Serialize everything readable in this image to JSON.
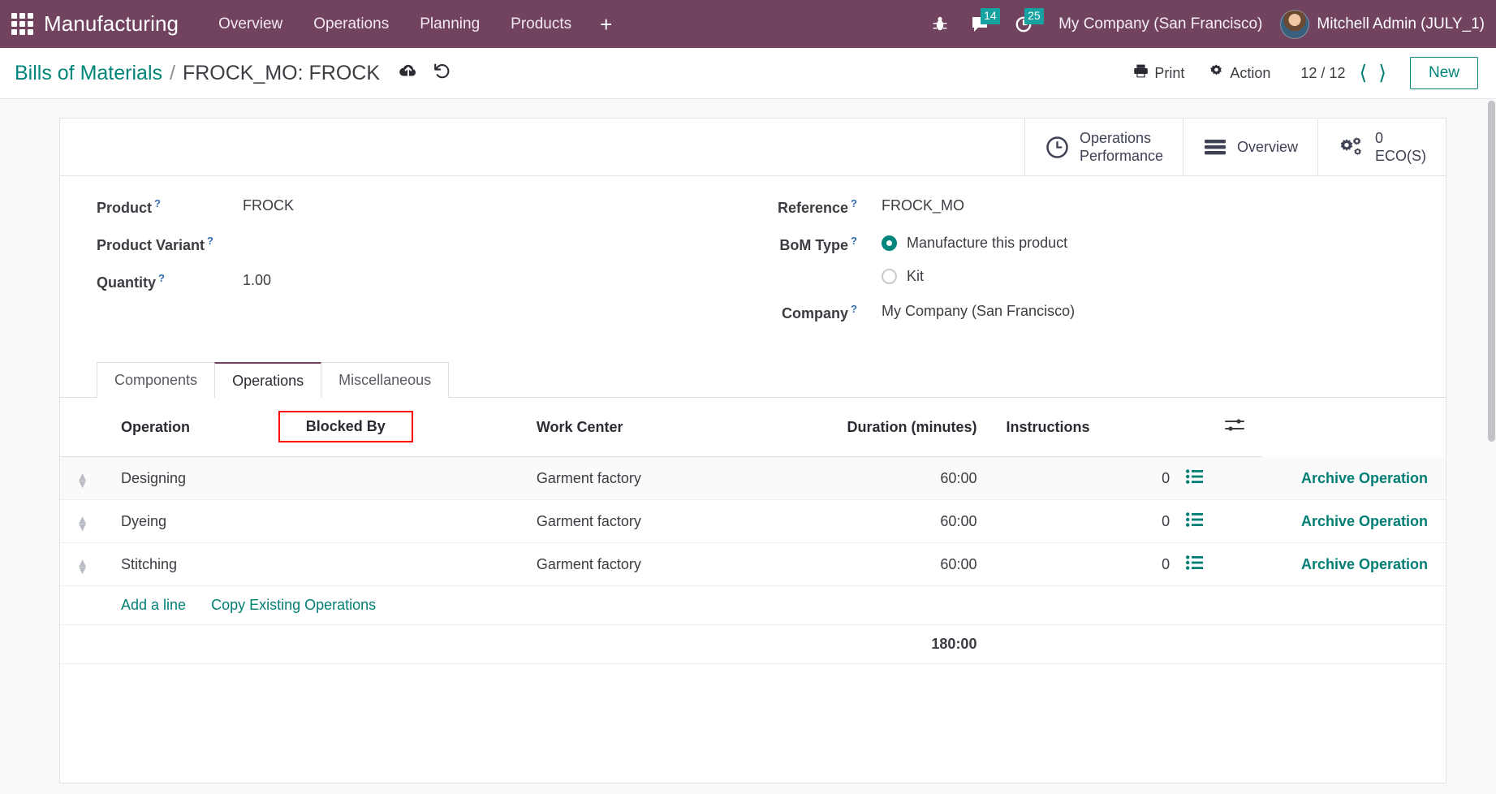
{
  "navbar": {
    "apps_icon": "apps-grid-icon",
    "brand": "Manufacturing",
    "menu": [
      {
        "label": "Overview"
      },
      {
        "label": "Operations"
      },
      {
        "label": "Planning"
      },
      {
        "label": "Products"
      }
    ],
    "plus_label": "+",
    "systray": {
      "debug_icon": "bug-icon",
      "messages_icon": "chat-icon",
      "messages_count": "14",
      "activities_icon": "clock-icon",
      "activities_count": "25",
      "company": "My Company (San Francisco)",
      "user": "Mitchell Admin (JULY_1)",
      "avatar": "user-avatar"
    }
  },
  "control_panel": {
    "breadcrumb_parent": "Bills of Materials",
    "breadcrumb_separator": "/",
    "breadcrumb_current": "FROCK_MO: FROCK",
    "save_icon": "cloud-upload-icon",
    "discard_icon": "undo-icon",
    "print_label": "Print",
    "print_icon": "printer-icon",
    "action_label": "Action",
    "action_icon": "gear-icon",
    "pager": "12 / 12",
    "prev_icon": "chevron-left-icon",
    "next_icon": "chevron-right-icon",
    "new_label": "New"
  },
  "stat_buttons": [
    {
      "icon": "clock-icon",
      "line1": "Operations",
      "line2": "Performance"
    },
    {
      "icon": "bars-icon",
      "line1": "Overview",
      "line2": ""
    },
    {
      "icon": "gears-icon",
      "line1": "0",
      "line2": "ECO(S)"
    }
  ],
  "form": {
    "left": [
      {
        "label": "Product",
        "help": "?",
        "value": "FROCK"
      },
      {
        "label": "Product Variant",
        "help": "?",
        "value": ""
      },
      {
        "label": "Quantity",
        "help": "?",
        "value": "1.00"
      }
    ],
    "right": {
      "reference": {
        "label": "Reference",
        "help": "?",
        "value": "FROCK_MO"
      },
      "bom_type": {
        "label": "BoM Type",
        "help": "?",
        "options": [
          {
            "label": "Manufacture this product",
            "selected": true
          },
          {
            "label": "Kit",
            "selected": false
          }
        ]
      },
      "company": {
        "label": "Company",
        "help": "?",
        "value": "My Company (San Francisco)"
      }
    }
  },
  "notebook": {
    "tabs": [
      {
        "label": "Components",
        "active": false
      },
      {
        "label": "Operations",
        "active": true
      },
      {
        "label": "Miscellaneous",
        "active": false
      }
    ]
  },
  "table": {
    "headers": {
      "operation": "Operation",
      "blocked_by": "Blocked By",
      "work_center": "Work Center",
      "duration": "Duration (minutes)",
      "instructions": "Instructions",
      "options_icon": "table-options-icon"
    },
    "highlight_color": "#ff0000",
    "rows": [
      {
        "handle": "drag-handle-icon",
        "operation": "Designing",
        "blocked_by": "",
        "work_center": "Garment factory",
        "duration": "60:00",
        "instructions": "0",
        "instructions_icon": "list-icon",
        "archive_label": "Archive Operation"
      },
      {
        "handle": "drag-handle-icon",
        "operation": "Dyeing",
        "blocked_by": "",
        "work_center": "Garment factory",
        "duration": "60:00",
        "instructions": "0",
        "instructions_icon": "list-icon",
        "archive_label": "Archive Operation"
      },
      {
        "handle": "drag-handle-icon",
        "operation": "Stitching",
        "blocked_by": "",
        "work_center": "Garment factory",
        "duration": "60:00",
        "instructions": "0",
        "instructions_icon": "list-icon",
        "archive_label": "Archive Operation"
      }
    ],
    "add_line_label": "Add a line",
    "copy_label": "Copy Existing Operations",
    "total_duration": "180:00"
  }
}
